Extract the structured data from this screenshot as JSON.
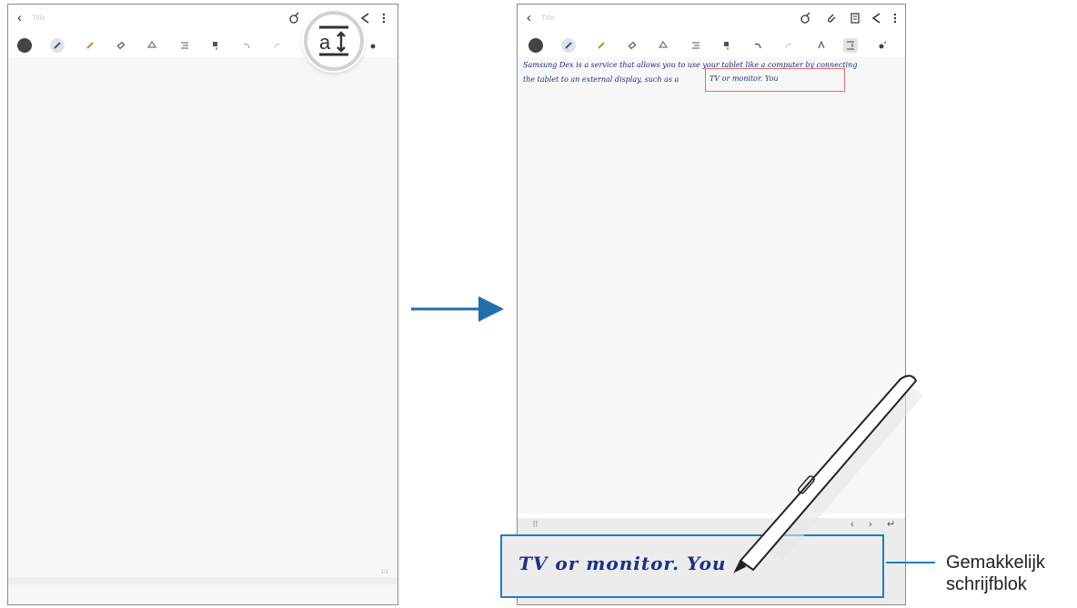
{
  "left_screen": {
    "title_placeholder": "Title",
    "page_indicator": "1/1",
    "magnifier_icon": "text-size-icon"
  },
  "right_screen": {
    "title_placeholder": "Title",
    "note_line1": "Samsung Dex is a service that allows you to use your tablet like a computer by connecting",
    "note_line2": "the tablet to an external display, such as a",
    "selected_text": "TV or monitor. You",
    "pad_text": "TV or monitor. You"
  },
  "callout": {
    "line1": "Gemakkelijk",
    "line2": "schrijfblok"
  },
  "colors": {
    "accent": "#1f7fc0",
    "ink": "#1a2f8a",
    "selection": "#e86b6b"
  }
}
